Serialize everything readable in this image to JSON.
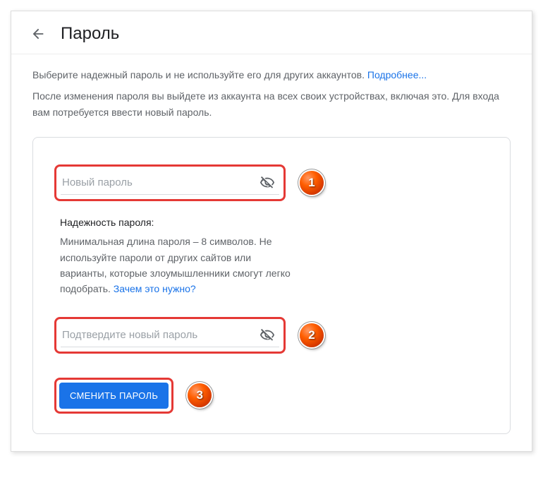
{
  "header": {
    "title": "Пароль"
  },
  "intro": {
    "line1": "Выберите надежный пароль и не используйте его для других аккаунтов.",
    "learn_more": "Подробнее...",
    "line2": "После изменения пароля вы выйдете из аккаунта на всех своих устройствах, включая это. Для входа вам потребуется ввести новый пароль."
  },
  "fields": {
    "new_password_placeholder": "Новый пароль",
    "confirm_password_placeholder": "Подтвердите новый пароль"
  },
  "strength": {
    "title": "Надежность пароля:",
    "text": "Минимальная длина пароля – 8 символов. Не используйте пароли от других сайтов или варианты, которые злоумышленники смогут легко подобрать.",
    "why_link": "Зачем это нужно?"
  },
  "button": {
    "label": "СМЕНИТЬ ПАРОЛЬ"
  },
  "annotations": {
    "badge1": "1",
    "badge2": "2",
    "badge3": "3"
  }
}
